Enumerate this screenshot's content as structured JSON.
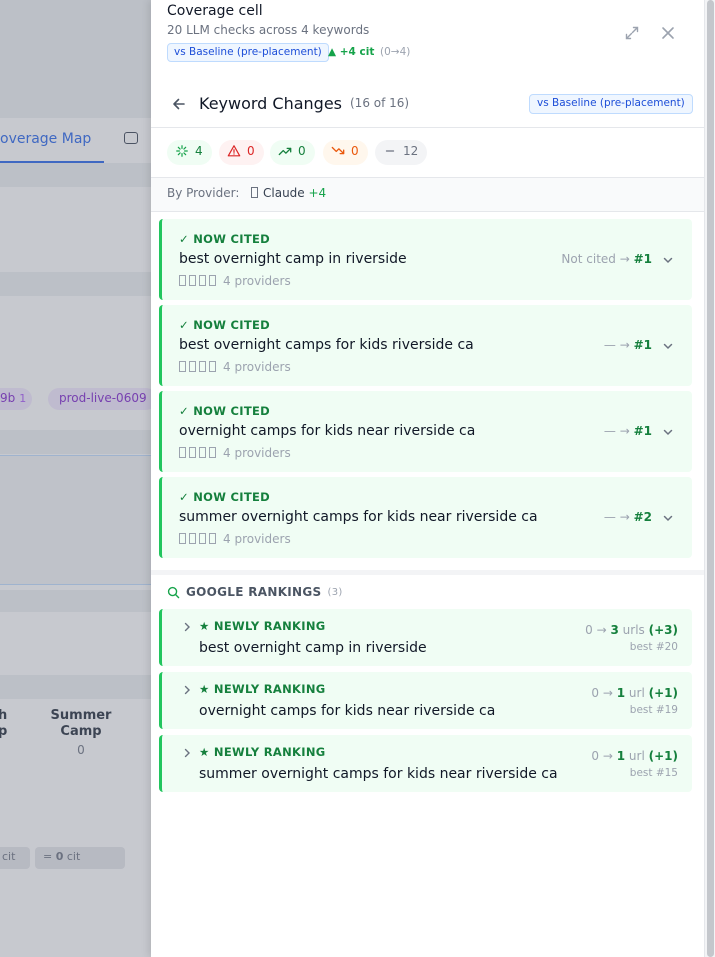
{
  "background": {
    "tab_label": "overage Map",
    "chip1_text": "9b",
    "chip1_count": "1",
    "chip2_text": "prod-live-0609",
    "col_left_line1": "h",
    "col_left_line2": "p",
    "col_summer_line1": "Summer",
    "col_summer_line2": "Camp",
    "col_summer_count": "0",
    "pill_left": "cit",
    "pill_mid_eq": "=",
    "pill_mid_val": "0",
    "pill_mid_unit": "cit"
  },
  "coverage": {
    "title": "Coverage cell",
    "subtitle": "20 LLM checks across 4 keywords",
    "baseline_badge": "vs Baseline (pre-placement)",
    "delta": "▲ +4 cit",
    "delta_range": "(0→4)"
  },
  "keyword_changes": {
    "title": "Keyword Changes",
    "count": "(16 of 16)",
    "baseline_badge": "vs Baseline (pre-placement)"
  },
  "filters": [
    {
      "name": "new-citation-filter",
      "count": "4"
    },
    {
      "name": "lost-filter",
      "count": "0"
    },
    {
      "name": "improved-filter",
      "count": "0"
    },
    {
      "name": "declined-filter",
      "count": "0"
    },
    {
      "name": "unchanged-filter",
      "count": "12"
    }
  ],
  "by_provider": {
    "label": "By Provider:",
    "provider": "Claude",
    "delta": "+4"
  },
  "llm_changes": [
    {
      "status": "✓ NOW CITED",
      "keyword": "best overnight camp in riverside",
      "providers": "4 providers",
      "from": "Not cited →",
      "to": "#1"
    },
    {
      "status": "✓ NOW CITED",
      "keyword": "best overnight camps for kids riverside ca",
      "providers": "4 providers",
      "from": "— →",
      "to": "#1"
    },
    {
      "status": "✓ NOW CITED",
      "keyword": "overnight camps for kids near riverside ca",
      "providers": "4 providers",
      "from": "— →",
      "to": "#1"
    },
    {
      "status": "✓ NOW CITED",
      "keyword": "summer overnight camps for kids near riverside ca",
      "providers": "4 providers",
      "from": "— →",
      "to": "#2"
    }
  ],
  "google_rankings": {
    "title": "GOOGLE RANKINGS",
    "count": "(3)",
    "items": [
      {
        "status": "★ NEWLY RANKING",
        "keyword": "best overnight camp in riverside",
        "from": "0 →",
        "to": "3",
        "unit": "urls",
        "delta": "(+3)",
        "best": "best #20"
      },
      {
        "status": "★ NEWLY RANKING",
        "keyword": "overnight camps for kids near riverside ca",
        "from": "0 →",
        "to": "1",
        "unit": "url",
        "delta": "(+1)",
        "best": "best #19"
      },
      {
        "status": "★ NEWLY RANKING",
        "keyword": "summer overnight camps for kids near riverside ca",
        "from": "0 →",
        "to": "1",
        "unit": "url",
        "delta": "(+1)",
        "best": "best #15"
      }
    ]
  },
  "colors": {
    "accent_blue": "#2563eb",
    "success_green": "#15803d",
    "card_green_bg": "#f0fdf4",
    "card_green_border": "#22c55e",
    "danger_red": "#dc2626",
    "warning_orange": "#ea580c"
  }
}
